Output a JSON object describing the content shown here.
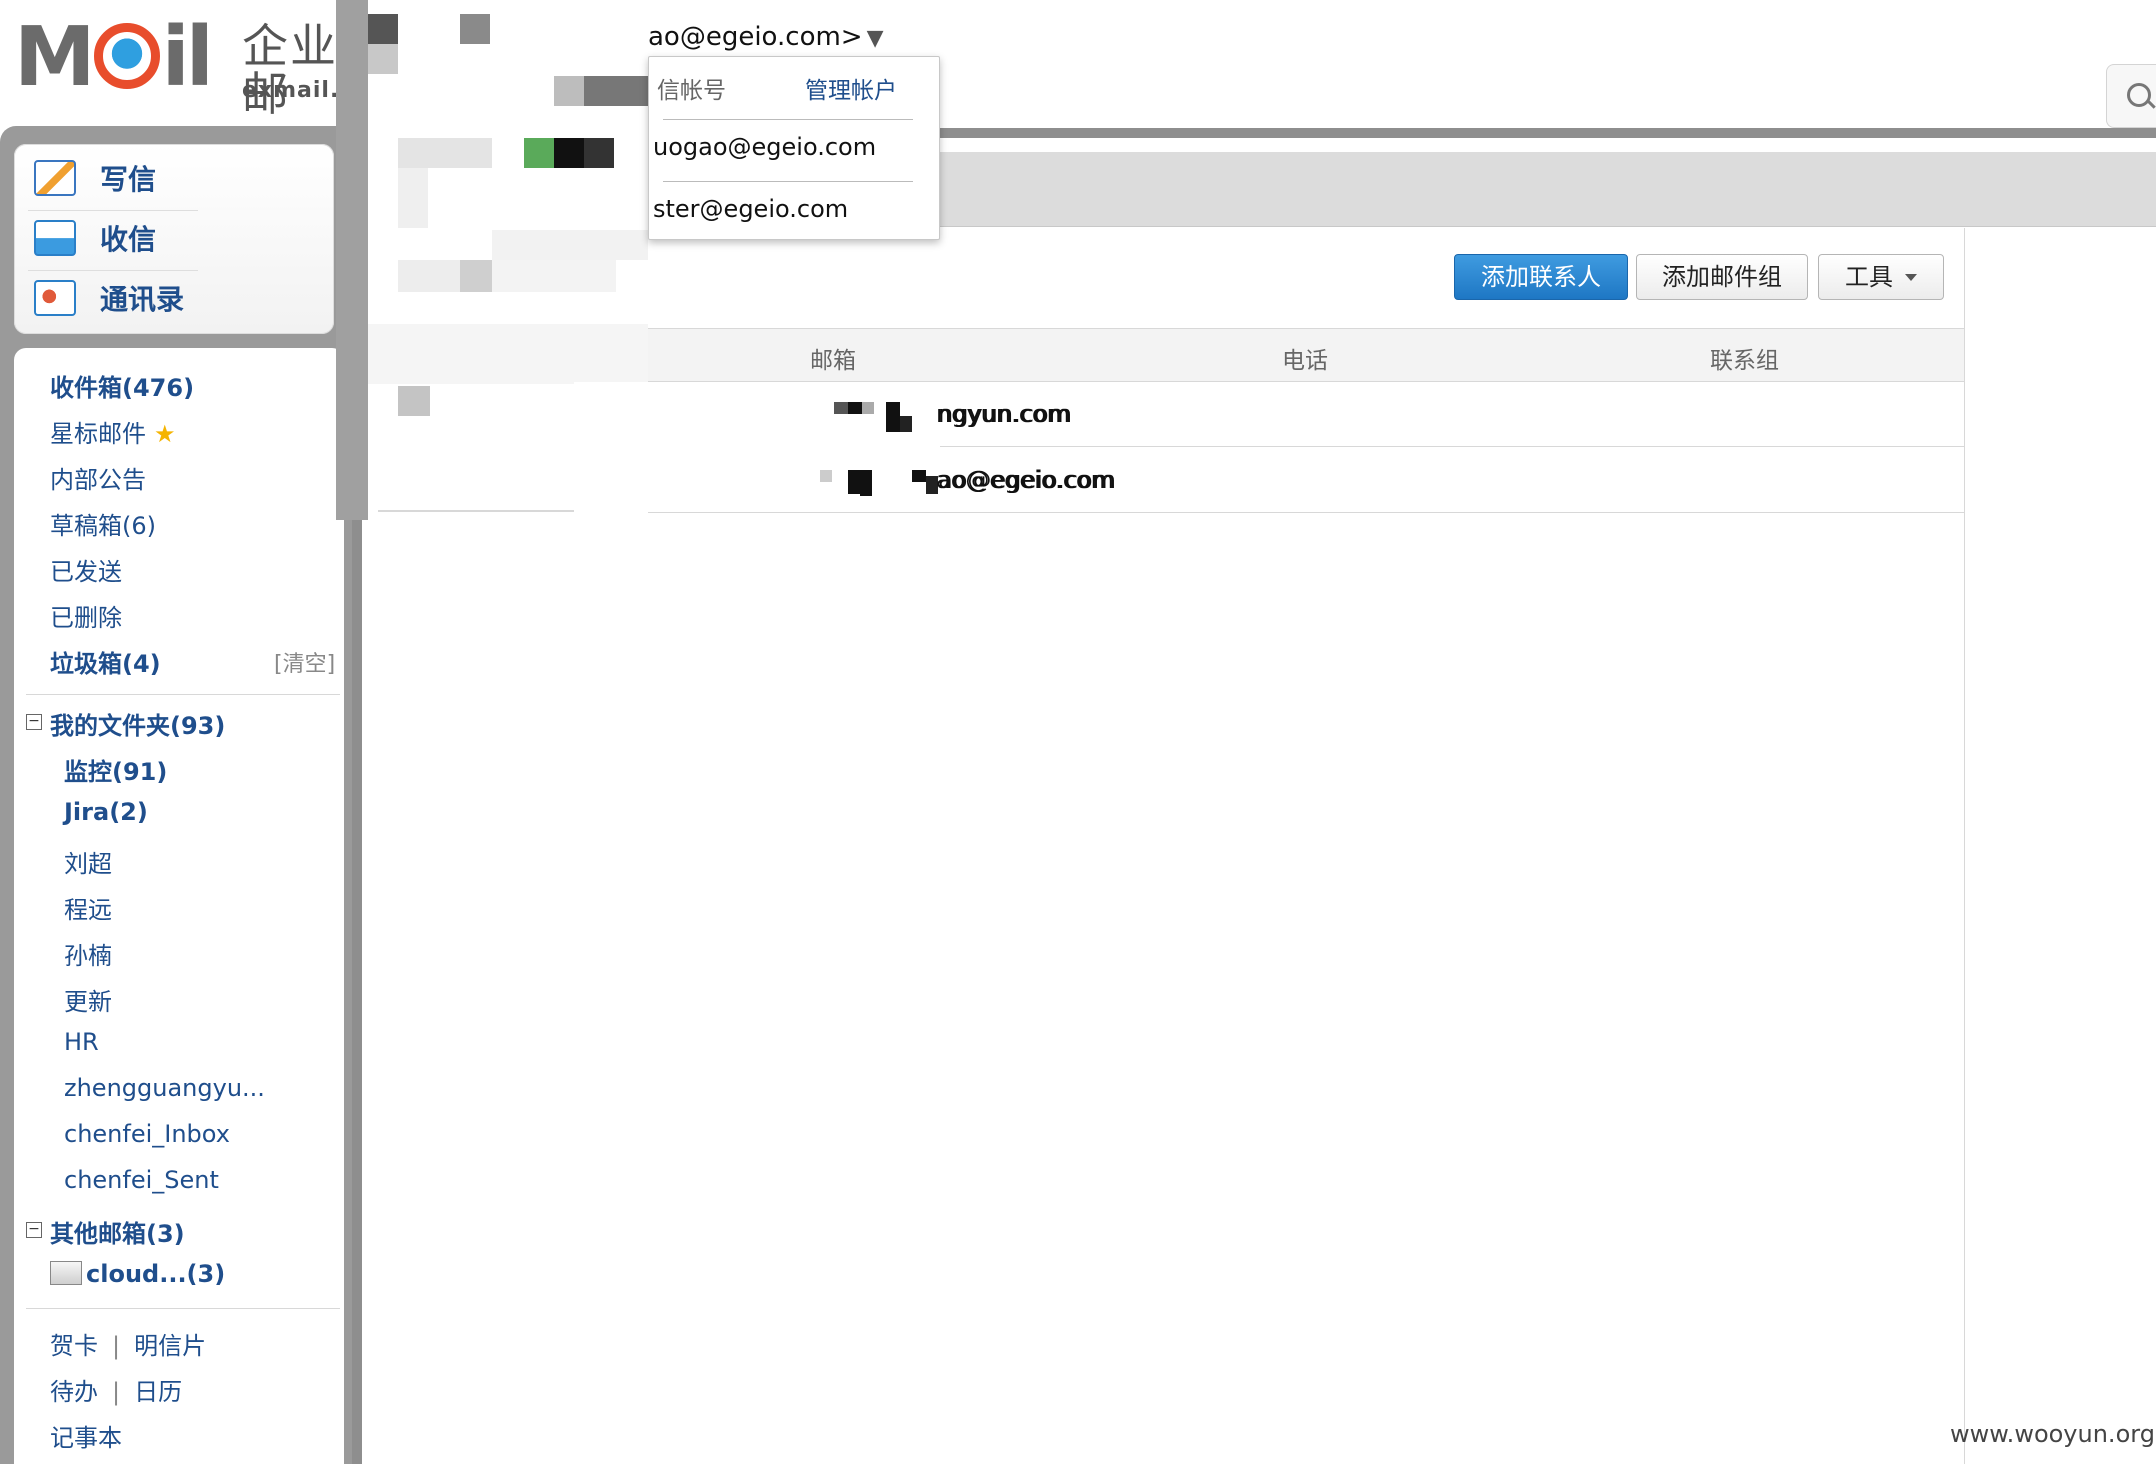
{
  "header": {
    "logo_brand": "Mail",
    "logo_cn": "企业邮",
    "logo_domain": "exmail.q",
    "current_account": "ao@egeio.com>",
    "account_caret": "▼",
    "search_icon": "search-icon"
  },
  "account_menu": {
    "label": "信帐号",
    "manage_label": "管理帐户",
    "accounts": [
      "uogao@egeio.com",
      "ster@egeio.com"
    ]
  },
  "quick_actions": [
    {
      "label": "写信",
      "icon": "compose-icon"
    },
    {
      "label": "收信",
      "icon": "inbox-download-icon"
    },
    {
      "label": "通讯录",
      "icon": "address-book-icon"
    }
  ],
  "folders": {
    "inbox": "收件箱(476)",
    "starred": "星标邮件",
    "star_icon": "★",
    "notices": "内部公告",
    "drafts": "草稿箱(6)",
    "sent": "已发送",
    "deleted": "已删除",
    "spam": "垃圾箱(4)",
    "spam_clear": "[清空]"
  },
  "my_folders": {
    "toggle": "−",
    "title": "我的文件夹(93)",
    "items": [
      "监控(91)",
      "Jira(2)",
      "刘超",
      "程远",
      "孙楠",
      "更新",
      "HR",
      "zhengguangyu...",
      "chenfei_Inbox",
      "chenfei_Sent"
    ]
  },
  "other_mailboxes": {
    "toggle": "−",
    "title": "其他邮箱(3)",
    "items": [
      "cloud...(3)"
    ]
  },
  "tools": {
    "greeting_card": "贺卡",
    "postcard": "明信片",
    "todo": "待办",
    "calendar": "日历",
    "notepad": "记事本",
    "separator": "|"
  },
  "toolbar": {
    "add_contact": "添加联系人",
    "add_group": "添加邮件组",
    "tools": "工具"
  },
  "contacts_table": {
    "columns": [
      "邮箱",
      "电话",
      "联系组"
    ],
    "rows": [
      {
        "email": "ngyun.com",
        "phone": "",
        "group": ""
      },
      {
        "email": "ao@egeio.com",
        "phone": "",
        "group": ""
      }
    ]
  },
  "watermark": "www.wooyun.org",
  "colors": {
    "link": "#1f4e8c",
    "primary_button": "#2a86d0",
    "chrome_gray": "#8e8e8e"
  }
}
